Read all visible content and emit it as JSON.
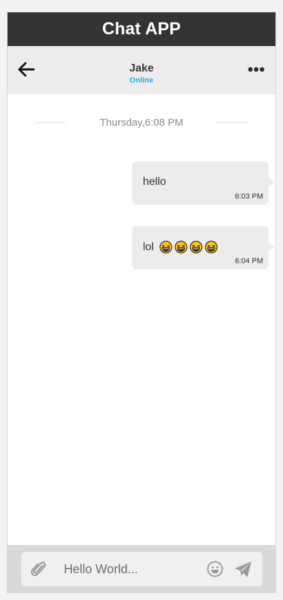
{
  "app": {
    "title": "Chat APP"
  },
  "contact": {
    "name": "Jake",
    "status": "Online",
    "status_color": "#2aa7e8"
  },
  "conversation": {
    "date_label": "Thursday,6:08 PM",
    "messages": [
      {
        "text": "hello",
        "emojis": [],
        "time": "6:03 PM",
        "direction": "outgoing"
      },
      {
        "text": "lol",
        "emojis": [
          "laughing-emoji",
          "laughing-emoji",
          "laughing-emoji",
          "laughing-emoji"
        ],
        "time": "6:04 PM",
        "direction": "outgoing"
      }
    ]
  },
  "composer": {
    "placeholder": "Hello World..."
  },
  "icons": {
    "back": "arrow-left-icon",
    "more": "more-options-icon",
    "attach": "paperclip-icon",
    "emoji": "smiley-icon",
    "send": "paper-plane-icon"
  },
  "colors": {
    "title_bar": "#343434",
    "header_bg": "#edebeb",
    "bubble_bg": "#edebeb",
    "input_bar_bg": "#d9d9d9",
    "online": "#2aa7e8"
  }
}
